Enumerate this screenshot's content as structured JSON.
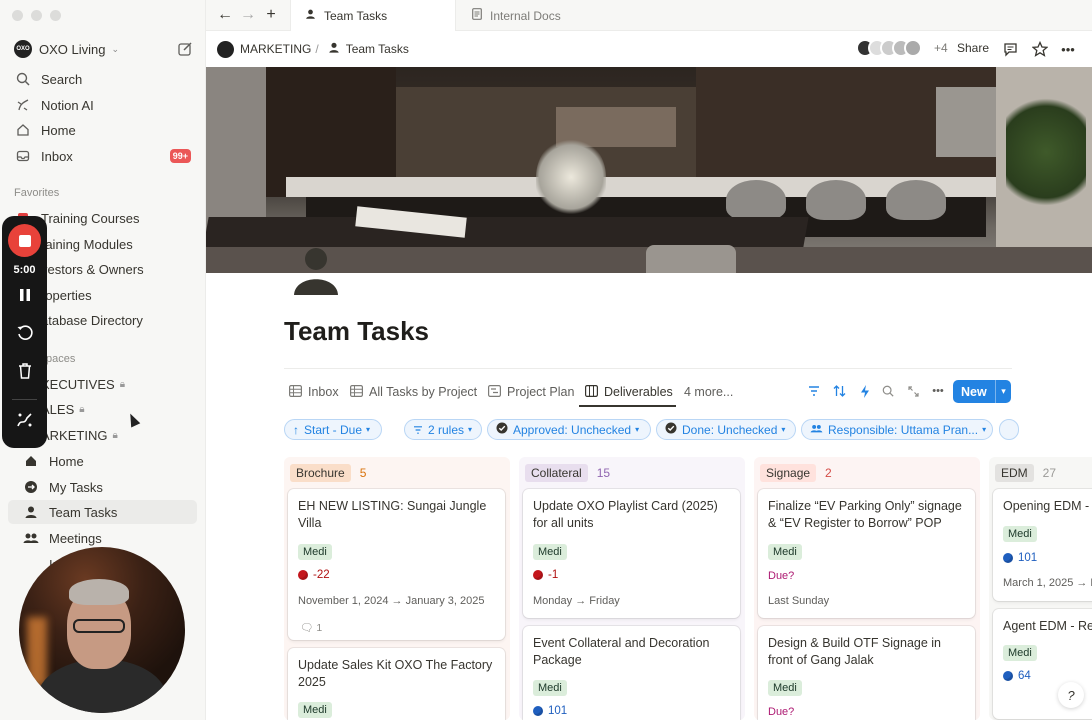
{
  "sidebar": {
    "workspace": "OXO Living",
    "top_items": [
      {
        "label": "Search"
      },
      {
        "label": "Notion AI"
      },
      {
        "label": "Home"
      },
      {
        "label": "Inbox",
        "badge": "99+"
      }
    ],
    "favorites_label": "Favorites",
    "favorites": [
      "Training Courses",
      "raining Modules",
      "vestors & Owners",
      "roperties",
      "atabase Directory"
    ],
    "teamspaces_label": "paces",
    "teamspaces": [
      "XECUTIVES",
      "ALES",
      "ARKETING"
    ],
    "marketing_children": [
      "Home",
      "My Tasks",
      "Team Tasks",
      "Meetings",
      "In"
    ],
    "recorder_time": "5:00"
  },
  "tabbar": {
    "tabs": [
      {
        "label": "Team Tasks",
        "active": true
      },
      {
        "label": "Internal Docs",
        "active": false
      }
    ]
  },
  "pagebar": {
    "breadcrumb_root": "MARKETING",
    "breadcrumb_sep": "/",
    "breadcrumb_page": "Team Tasks",
    "extra_count": "+4",
    "share": "Share"
  },
  "page": {
    "title": "Team Tasks",
    "views": [
      "Inbox",
      "All Tasks by Project",
      "Project Plan",
      "Deliverables",
      "4 more..."
    ],
    "new_button": "New",
    "filters": [
      "Start - Due",
      "2 rules",
      "Approved: Unchecked",
      "Done: Unchecked",
      "Responsible: Uttama Pran..."
    ]
  },
  "board": {
    "columns": [
      {
        "name": "Brochure",
        "count": "5",
        "tag_color": "#fadec9",
        "bg": "#fdf5f2",
        "cards": [
          {
            "title": "EH NEW LISTING: Sungai Jungle Villa",
            "tag": "Medi",
            "value": "-22",
            "value_color": "red",
            "date": "November 1, 2024 → January 3, 2025",
            "comments": "1"
          },
          {
            "title": "Update Sales Kit OXO The Factory 2025",
            "tag": "Medi"
          }
        ]
      },
      {
        "name": "Collateral",
        "count": "15",
        "tag_color": "#e8deee",
        "bg": "#f8f5fa",
        "cards": [
          {
            "title": "Update OXO Playlist Card (2025) for all units",
            "tag": "Medi",
            "value": "-1",
            "value_color": "red",
            "date": "Monday → Friday"
          },
          {
            "title": "Event Collateral and Decoration Package",
            "tag": "Medi",
            "value": "101",
            "value_color": "blue"
          }
        ]
      },
      {
        "name": "Signage",
        "count": "2",
        "tag_color": "#ffe2dd",
        "bg": "#fdf4f3",
        "cards": [
          {
            "title": "Finalize “EV Parking Only” signage & “EV Register to Borrow” POP",
            "tag": "Medi",
            "due": "Due?",
            "date": "Last Sunday"
          },
          {
            "title": "Design & Build OTF Signage in front of Gang Jalak",
            "tag": "Medi",
            "due": "Due?"
          }
        ]
      },
      {
        "name": "EDM",
        "count": "27",
        "tag_color": "#e3e2e0",
        "bg": "#f7f7f5",
        "cards": [
          {
            "title": "Opening EDM - I",
            "tag": "Medi",
            "value": "101",
            "value_color": "blue",
            "date": "March 1, 2025 → M"
          },
          {
            "title": "Agent EDM - Re",
            "tag": "Medi",
            "value": "64",
            "value_color": "blue"
          }
        ]
      }
    ]
  }
}
